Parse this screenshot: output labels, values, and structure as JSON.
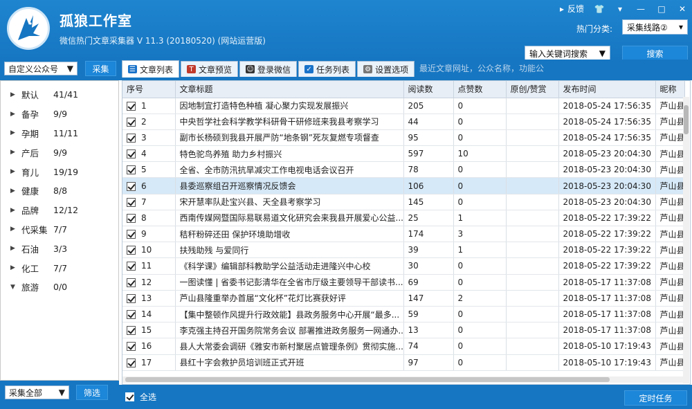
{
  "header": {
    "title": "孤狼工作室",
    "subtitle": "微信热门文章采集器  V 11.3 (20180520)  (网站运营版)",
    "feedback": "反馈",
    "hot_label": "热门分类:",
    "hot_value": "采集线路②",
    "keyword_placeholder": "输入关键词搜索",
    "search_btn": "搜索",
    "url_placeholder": "最近文章网址，公众名称，功能公"
  },
  "left": {
    "account_select": "自定义公众号",
    "collect_btn": "采集",
    "tree": [
      {
        "name": "默认",
        "count": "41/41",
        "expanded": false
      },
      {
        "name": "备孕",
        "count": "9/9",
        "expanded": false
      },
      {
        "name": "孕期",
        "count": "11/11",
        "expanded": false
      },
      {
        "name": "产后",
        "count": "9/9",
        "expanded": false
      },
      {
        "name": "育儿",
        "count": "19/19",
        "expanded": false
      },
      {
        "name": "健康",
        "count": "8/8",
        "expanded": false
      },
      {
        "name": "品牌",
        "count": "12/12",
        "expanded": false
      },
      {
        "name": "代采集",
        "count": "7/7",
        "expanded": false
      },
      {
        "name": "石油",
        "count": "3/3",
        "expanded": false
      },
      {
        "name": "化工",
        "count": "7/7",
        "expanded": false
      },
      {
        "name": "旅游",
        "count": "0/0",
        "expanded": true
      }
    ],
    "collect_all": "采集全部",
    "filter_btn": "筛选"
  },
  "tabs": [
    {
      "label": "文章列表",
      "icon": "list-icon",
      "color": "#1a73c9"
    },
    {
      "label": "文章预览",
      "icon": "preview-icon",
      "color": "#c0392b"
    },
    {
      "label": "登录微信",
      "icon": "user-icon",
      "color": "#333333"
    },
    {
      "label": "任务列表",
      "icon": "task-check-icon",
      "color": "#1a73c9"
    },
    {
      "label": "设置选项",
      "icon": "gear-icon",
      "color": "#777777"
    }
  ],
  "table": {
    "columns": [
      "序号",
      "文章标题",
      "阅读数",
      "点赞数",
      "原创/赞赏",
      "发布时间",
      "昵称"
    ],
    "rows": [
      [
        "1",
        "因地制宜打造特色种植 凝心聚力实现发展振兴",
        "205",
        "0",
        "",
        "2018-05-24 17:56:35",
        "芦山县,"
      ],
      [
        "2",
        "中央哲学社会科学教学科研骨干研修班来我县考察学习",
        "44",
        "0",
        "",
        "2018-05-24 17:56:35",
        "芦山县,"
      ],
      [
        "3",
        "副市长杨硕到我县开展严防“地条钢”死灰复燃专项督查",
        "95",
        "0",
        "",
        "2018-05-24 17:56:35",
        "芦山县,"
      ],
      [
        "4",
        "特色驼鸟养殖 助力乡村振兴",
        "597",
        "10",
        "",
        "2018-05-23 20:04:30",
        "芦山县,"
      ],
      [
        "5",
        "全省、全市防汛抗旱减灾工作电视电话会议召开",
        "78",
        "0",
        "",
        "2018-05-23 20:04:30",
        "芦山县,"
      ],
      [
        "6",
        "县委巡察组召开巡察情况反馈会",
        "106",
        "0",
        "",
        "2018-05-23 20:04:30",
        "芦山县,"
      ],
      [
        "7",
        "宋开慧率队赴宝兴县、天全县考察学习",
        "145",
        "0",
        "",
        "2018-05-23 20:04:30",
        "芦山县,"
      ],
      [
        "8",
        "西南传媒网暨国际易联易道文化研究会来我县开展爱心公益...",
        "25",
        "1",
        "",
        "2018-05-22 17:39:22",
        "芦山县,"
      ],
      [
        "9",
        "秸秆粉碎还田 保护环境助增收",
        "174",
        "3",
        "",
        "2018-05-22 17:39:22",
        "芦山县,"
      ],
      [
        "10",
        "扶残助残 与爱同行",
        "39",
        "1",
        "",
        "2018-05-22 17:39:22",
        "芦山县,"
      ],
      [
        "11",
        "《科学课》编辑部科教助学公益活动走进隆兴中心校",
        "30",
        "0",
        "",
        "2018-05-22 17:39:22",
        "芦山县,"
      ],
      [
        "12",
        "一图读懂 | 省委书记彭清华在全省市厅级主要领导干部读书...",
        "69",
        "0",
        "",
        "2018-05-17 11:37:08",
        "芦山县,"
      ],
      [
        "13",
        "芦山县隆重举办首届“文化杯”花灯比赛获好评",
        "147",
        "2",
        "",
        "2018-05-17 11:37:08",
        "芦山县,"
      ],
      [
        "14",
        "【集中整顿作风提升行政效能】县政务服务中心开展“最多...",
        "59",
        "0",
        "",
        "2018-05-17 11:37:08",
        "芦山县,"
      ],
      [
        "15",
        "李克强主持召开国务院常务会议  部署推进政务服务一网通办...",
        "13",
        "0",
        "",
        "2018-05-17 11:37:08",
        "芦山县,"
      ],
      [
        "16",
        "县人大常委会调研《雅安市新村聚居点管理条例》贯彻实施...",
        "74",
        "0",
        "",
        "2018-05-10 17:19:43",
        "芦山县,"
      ],
      [
        "17",
        "县红十字会救护员培训班正式开班",
        "97",
        "0",
        "",
        "2018-05-10 17:19:43",
        "芦山县,"
      ]
    ],
    "selected_row": 5
  },
  "footer": {
    "select_all": "全选",
    "timer_btn": "定时任务"
  }
}
